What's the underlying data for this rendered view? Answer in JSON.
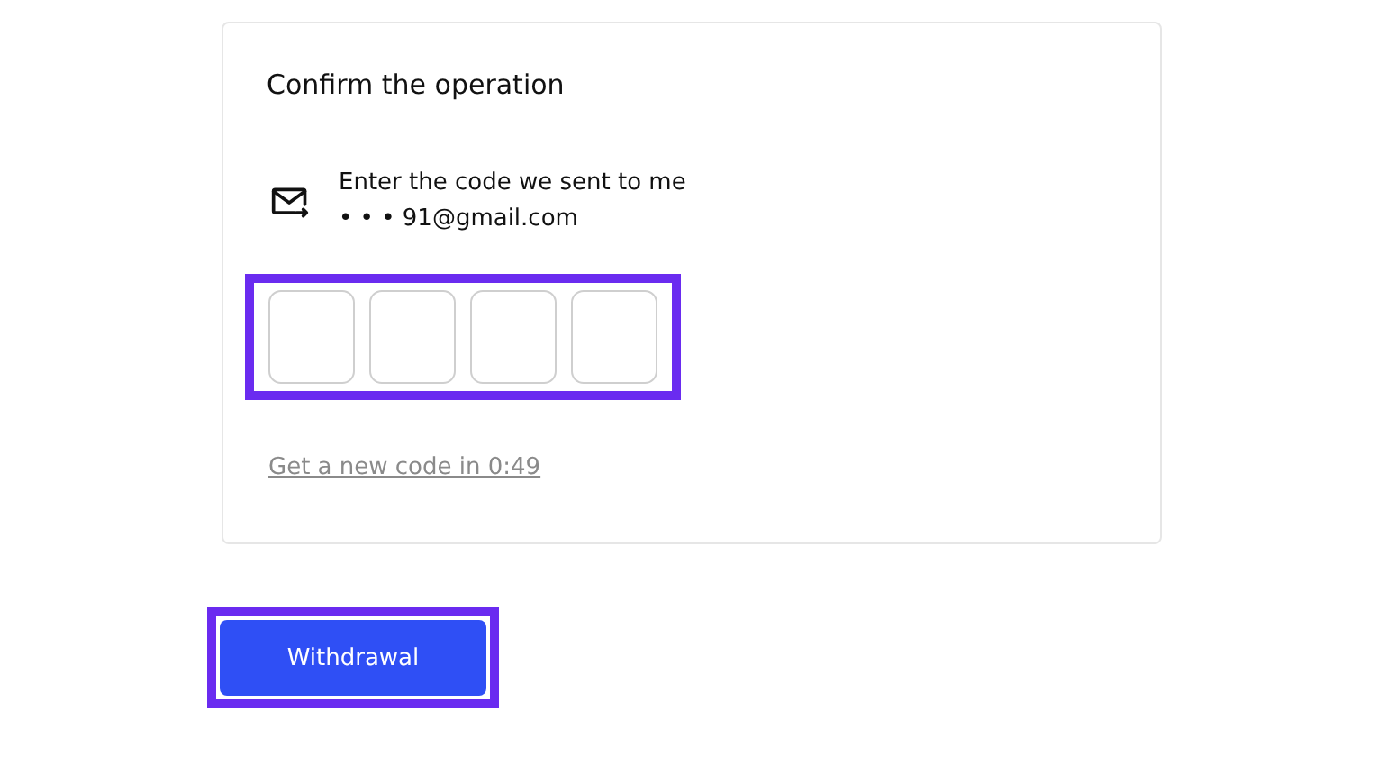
{
  "dialog": {
    "title": "Confirm the operation",
    "message": "Enter the code we sent to me • • • 91@gmail.com",
    "code_fields": {
      "highlighted": true,
      "fields": [
        {
          "kind": "digit"
        },
        {
          "kind": "digit"
        },
        {
          "kind": "digit"
        },
        {
          "kind": "digit"
        }
      ]
    },
    "resend_link": "Get a new code in 0:49"
  },
  "submit_button": {
    "label": "Withdrawal",
    "highlighted": true
  }
}
